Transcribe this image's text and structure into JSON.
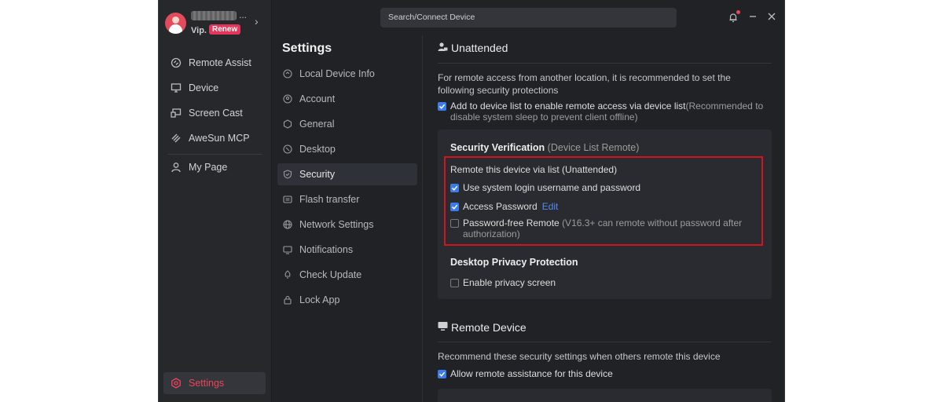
{
  "profile": {
    "vip_label": "Vip.",
    "renew_label": "Renew",
    "more": "..."
  },
  "nav": {
    "items": [
      {
        "label": "Remote Assist",
        "icon": "remote-assist-icon"
      },
      {
        "label": "Device",
        "icon": "monitor-icon"
      },
      {
        "label": "Screen Cast",
        "icon": "screen-cast-icon"
      },
      {
        "label": "AweSun MCP",
        "icon": "mcp-icon"
      },
      {
        "label": "My Page",
        "icon": "user-icon"
      }
    ],
    "settings_label": "Settings"
  },
  "search": {
    "placeholder": "Search/Connect Device"
  },
  "settings": {
    "title": "Settings",
    "items": [
      {
        "label": "Local Device Info",
        "icon": "device-info-icon"
      },
      {
        "label": "Account",
        "icon": "account-icon"
      },
      {
        "label": "General",
        "icon": "general-icon"
      },
      {
        "label": "Desktop",
        "icon": "desktop-icon"
      },
      {
        "label": "Security",
        "icon": "shield-icon"
      },
      {
        "label": "Flash transfer",
        "icon": "flash-transfer-icon"
      },
      {
        "label": "Network Settings",
        "icon": "globe-icon"
      },
      {
        "label": "Notifications",
        "icon": "notification-icon"
      },
      {
        "label": "Check Update",
        "icon": "update-icon"
      },
      {
        "label": "Lock App",
        "icon": "lock-icon"
      }
    ],
    "active": "Security"
  },
  "unattended": {
    "title": "Unattended",
    "description": "For remote access from another location, it is recommended to set the following security protections",
    "device_list_label": "Add to device list to enable remote access via device list",
    "device_list_note": "(Recommended to disable system sleep to prevent client offline)",
    "device_list_checked": true
  },
  "verification": {
    "title": "Security Verification",
    "subtitle": "(Device List Remote)",
    "group_label": "Remote this device via list (Unattended)",
    "options": [
      {
        "label": "Use system login username and password",
        "checked": true
      },
      {
        "label": "Access Password",
        "checked": true,
        "link": "Edit"
      },
      {
        "label": "Password-free Remote",
        "note": "(V16.3+ can remote without password after authorization)",
        "checked": false
      }
    ]
  },
  "privacy": {
    "title": "Desktop Privacy Protection",
    "option_label": "Enable privacy screen",
    "checked": false
  },
  "remote_device": {
    "title": "Remote Device",
    "description": "Recommend these security settings when others remote this device",
    "allow_label": "Allow remote assistance for this device",
    "allow_checked": true
  },
  "colors": {
    "accent": "#e8465a",
    "checkbox": "#3b7ce8",
    "highlight_box": "#d0151f"
  }
}
